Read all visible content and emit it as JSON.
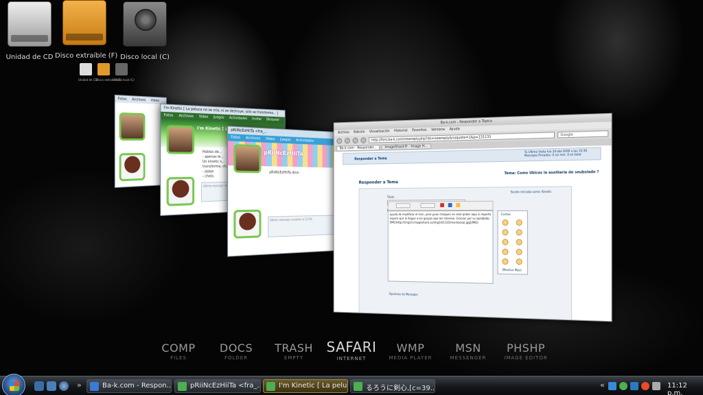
{
  "desktop": {
    "icons": [
      {
        "label": "Unidad de CD"
      },
      {
        "label": "Disco extraíble (F)"
      },
      {
        "label": "Disco local (C)"
      }
    ],
    "mini_icons": [
      {
        "label": "Unidad de CD"
      },
      {
        "label": "Disco extraíble (F)"
      },
      {
        "label": "Disco local (C)"
      }
    ]
  },
  "flip_windows": {
    "msn_back": {
      "menu": [
        "Fotos",
        "Archivos",
        "Video"
      ]
    },
    "msn_mid": {
      "title": "I'm Kinetic [ La peluca no se cria, ni se destruye, sólo se transforma... ]",
      "menu": [
        "Fotos",
        "Archivos",
        "Video",
        "Juegos",
        "Actividades",
        "Invitar",
        "Bloquear"
      ],
      "nick": "I'm Kinetic [ La peluca no se cria, ni s...",
      "message": "Hablas de...\n- apenas le...\nUn kinetic s...\ntransforma, ch...\n- jajaja\n- chelo.",
      "input_hint": "Ultimo mensaje recibido el 11:11"
    },
    "msn_front": {
      "title": "pRiiNcEzHiiTa <fra_...",
      "menu": [
        "Fotos",
        "Archivos",
        "Video",
        "Juegos",
        "Actividades"
      ],
      "header": "pRiiNcEzHiiTa",
      "line1": "pRiiNcEzHiiTa dice:",
      "input_hint": "Ultimo mensaje recibido el 11:09"
    },
    "browser": {
      "title": "Ba-k.com - Responder a Tópico",
      "menu": [
        "Archivo",
        "Edición",
        "Visualización",
        "Historial",
        "Favoritos",
        "Ventana",
        "Ayuda"
      ],
      "url": "http://foro.ba-k.com/newreply.php?do=newreply&noquote=1&p=131131",
      "search_placeholder": "Google",
      "tabs": [
        "Ba-k.com - Responder...",
        "ImageShack® - Image H..."
      ],
      "user_info": "Tu Ultima Visita fue 26-abr-2009 a las 10:36\nMensajes Privados: 0 sin leer, 0 en total",
      "breadcrumb": "Responder a Tema",
      "thread": "Tema: Como Ubicas la auxiliaria de seubsiado ?",
      "heading": "Responder a Tema",
      "logged_as": "Sesión iniciada como: Kinetic",
      "title_label": "Título",
      "title_value": "ayuda de modificar el msn",
      "message_label": "Mensaje",
      "font_select": "Fuentes",
      "size_select": "Tamaño",
      "editor_text": "ayuda de modificar el msn, pero pues chequen en este poder aqui si reporto espero que le llegue a los grupos que les interesa. Gracias por su aprobado.\n[IMG]http://img14.imageshack.us/img14/1135/msnhackal.jpg[/IMG]",
      "smileys_label": "Caritas",
      "more_label": "[Mostrar Más]",
      "options_label": "Opciones de Mensajes"
    }
  },
  "dock": [
    {
      "big": "COMP",
      "sub": "FILES"
    },
    {
      "big": "DOCS",
      "sub": "FOLDER"
    },
    {
      "big": "TRASH",
      "sub": "EMPTY"
    },
    {
      "big": "SAFARI",
      "sub": "INTERNET",
      "active": true
    },
    {
      "big": "WMP",
      "sub": "MEDIA PLAYER"
    },
    {
      "big": "MSN",
      "sub": "MESSENGER"
    },
    {
      "big": "PHSHP",
      "sub": "IMAGE EDITOR"
    }
  ],
  "taskbar": {
    "chevron_left": "»",
    "chevron_tray": "«",
    "buttons": [
      {
        "label": "Ba-k.com - Respon...",
        "icon_color": "#3a7bd5"
      },
      {
        "label": "pRiiNcEzHiiTa <fra_...",
        "icon_color": "#4caf50"
      },
      {
        "label": "I'm Kinetic [ La pelu...",
        "icon_color": "#4caf50"
      },
      {
        "label": "るろうに剣心,[c=39...",
        "icon_color": "#4caf50"
      }
    ],
    "clock": "11:12 p.m."
  },
  "colors": {
    "start_orb": "#2a5ea8",
    "active_task": "#6a5a2a",
    "msn_green": "#78c850",
    "drive_orange": "#e09a2a"
  }
}
